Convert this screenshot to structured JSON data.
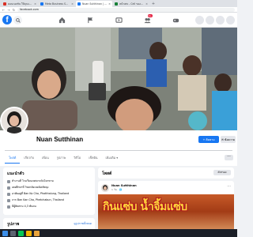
{
  "browser": {
    "tabs": [
      {
        "title": "คอนเนคชั่น ให้คุณเพิ่มเติม",
        "favicon_color": "#d93025",
        "active": false
      },
      {
        "title": "Meta Business Suite",
        "favicon_color": "#1877f2",
        "active": false
      },
      {
        "title": "Nuan Sutthinan | Facebook",
        "favicon_color": "#1877f2",
        "active": true
      },
      {
        "title": "หน้าเพจ - Cell ของยอดขายทั้ง",
        "favicon_color": "#188038",
        "active": false
      }
    ],
    "tab_close": "×",
    "new_tab": "+",
    "url": "facebook.com"
  },
  "fb": {
    "logo": "f",
    "notification_count": "9+"
  },
  "profile": {
    "name": "Nuan Sutthinan",
    "follow_button": "ติดตาม",
    "message_button": "ข้อความ",
    "tabs": [
      "โพสต์",
      "เกี่ยวกับ",
      "เพื่อน",
      "รูปภาพ",
      "วิดีโอ",
      "เช็คอิน",
      "เพิ่มเติม ▾"
    ],
    "more": "···"
  },
  "intro": {
    "title": "แนะนำตัว",
    "rows": [
      "ทำงานที่ โรงเรียนเทศบาลวัดโคกขาม",
      "เคยศึกษาที่ วิทยาลัยเทคนิคพัทลุง",
      "อาศัยอยู่ที่ Ban Ko Cho, Phatthalung, Thailand",
      "จาก Ban Kan Cha, Phetchabun, Thailand",
      "มีผู้ติดตาม 4,3 พันคน"
    ]
  },
  "photos": {
    "title": "รูปภาพ",
    "link": "ดูรูปภาพทั้งหมด"
  },
  "posts": {
    "title": "โพสต์",
    "filter": "ตัวกรอง",
    "first": {
      "author": "Nuan Sutthinan",
      "date": "1 วัน · 🌐",
      "more": "···",
      "image_text": "กินแซ่บ น้ำจิ้มแซ่บ"
    }
  },
  "colors": {
    "fb_blue": "#1877f2",
    "page_bg": "#f0f2f5"
  }
}
